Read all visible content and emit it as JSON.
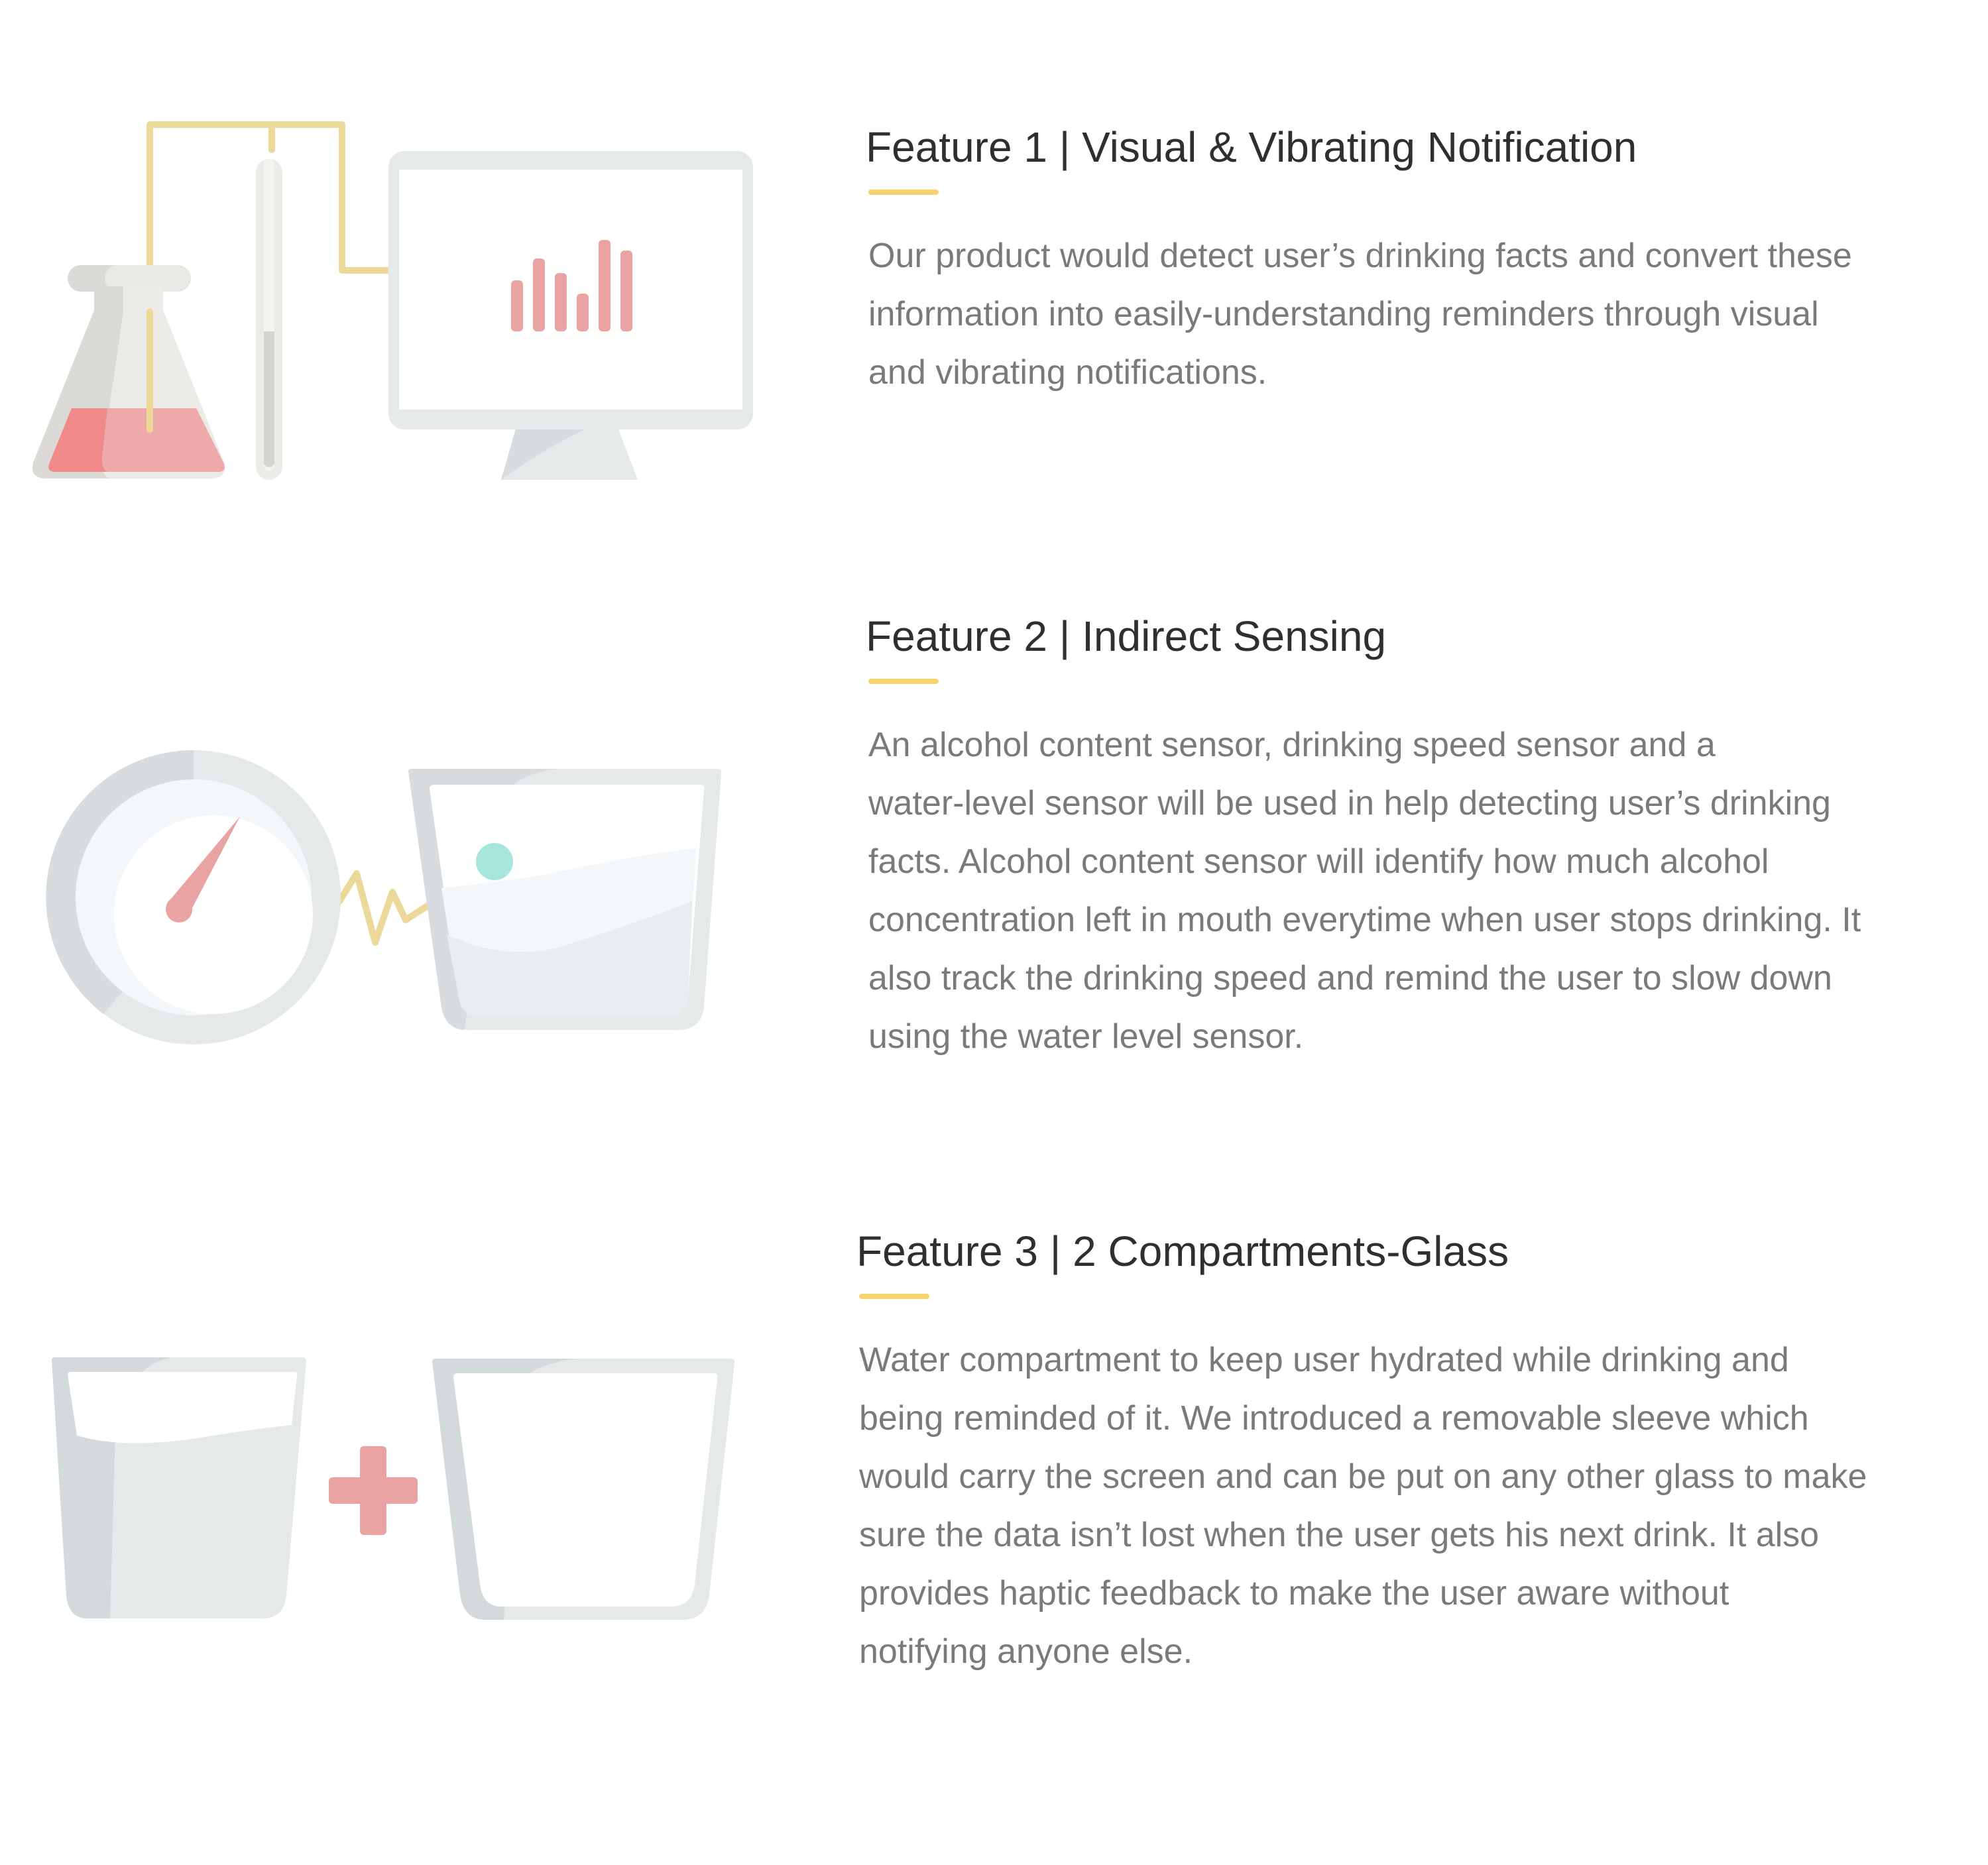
{
  "features": [
    {
      "title": "Feature 1 | Visual & Vibrating Notification",
      "lines": [
        "Our product would detect user’s drinking facts and convert these",
        "information into easily-understanding reminders through visual",
        "and vibrating notifications."
      ],
      "illustration": [
        "flask-icon",
        "test-tube-icon",
        "monitor-icon",
        "bar-chart-icon"
      ]
    },
    {
      "title": "Feature 2 | Indirect Sensing",
      "lines": [
        "An alcohol content sensor, drinking speed sensor and a",
        "water-level sensor will be used in help detecting user’s drinking",
        "facts. Alcohol content sensor will identify how much alcohol",
        "concentration left in mouth everytime when user stops drinking. It",
        "also track the drinking speed and remind the user to slow down",
        "using the water level sensor."
      ],
      "illustration": [
        "gauge-icon",
        "signal-zigzag-icon",
        "glass-with-sensor-icon"
      ]
    },
    {
      "title": "Feature 3 | 2 Compartments-Glass",
      "lines": [
        "Water compartment to keep user hydrated while drinking and",
        "being reminded of it. We introduced a removable sleeve which",
        "would carry the screen and can be put on any other glass to make",
        "sure the data isn’t lost when the user gets his next drink. It also",
        "provides haptic feedback to make the user aware without",
        "notifying anyone else."
      ],
      "illustration": [
        "full-glass-icon",
        "plus-icon",
        "empty-glass-icon"
      ]
    }
  ],
  "colors": {
    "accent": "#f7d36f",
    "title": "#2f2f2f",
    "body_text": "#7a7a7a",
    "illustration_red": "#eaa3a3",
    "illustration_gray": "#e6e9ea",
    "illustration_teal": "#a6e6dc"
  }
}
